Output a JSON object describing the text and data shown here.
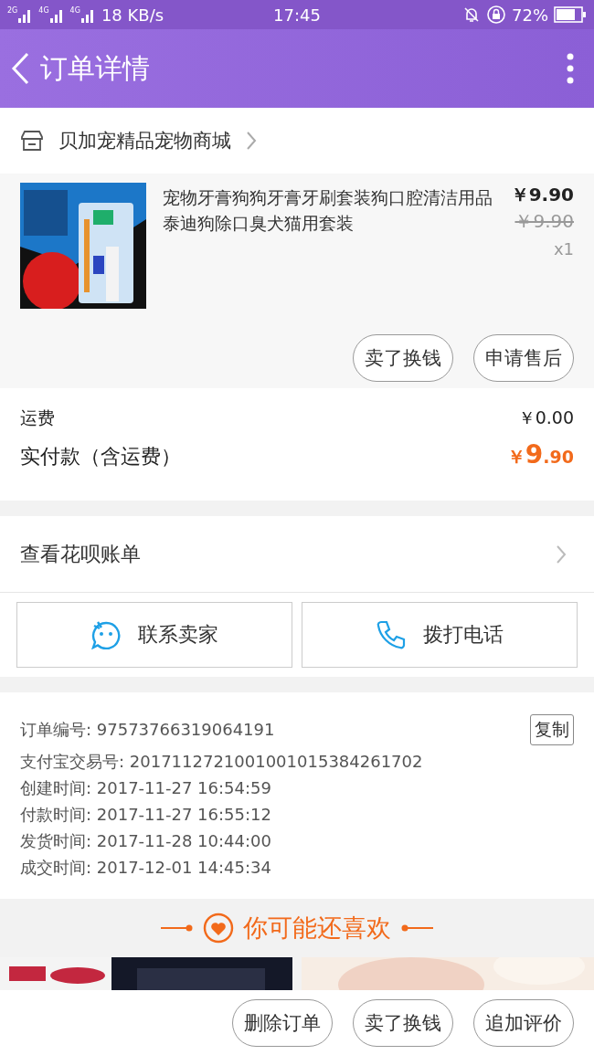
{
  "status_bar": {
    "signals": [
      {
        "label": "2G"
      },
      {
        "label": "4G"
      },
      {
        "label": "4G"
      }
    ],
    "speed": "18 KB/s",
    "time": "17:45",
    "battery": "72%"
  },
  "header": {
    "title": "订单详情"
  },
  "shop": {
    "name": "贝加宠精品宠物商城"
  },
  "product": {
    "kind": "picture",
    "title": "宠物牙膏狗狗牙膏牙刷套装狗口腔清洁用品泰迪狗除口臭犬猫用套装",
    "price": "￥9.90",
    "original_price": "￥9.90",
    "quantity": "x1",
    "actions": [
      "卖了换钱",
      "申请售后"
    ]
  },
  "fees": {
    "shipping_label": "运费",
    "shipping": "￥0.00",
    "paid_label": "实付款（含运费）",
    "paid_symbol": "￥",
    "paid_int": "9",
    "paid_dec": ".90"
  },
  "huabei": {
    "label": "查看花呗账单"
  },
  "contact": [
    {
      "kind": "chat",
      "label": "联系卖家"
    },
    {
      "kind": "phone",
      "label": "拨打电话"
    }
  ],
  "order_info": {
    "copy": "复制",
    "rows": [
      {
        "label": "订单编号:",
        "value": "97573766319064191"
      },
      {
        "label": "支付宝交易号:",
        "value": "2017112721001001015384261702"
      },
      {
        "label": "创建时间:",
        "value": "2017-11-27 16:54:59"
      },
      {
        "label": "付款时间:",
        "value": "2017-11-27 16:55:12"
      },
      {
        "label": "发货时间:",
        "value": "2017-11-28 10:44:00"
      },
      {
        "label": "成交时间:",
        "value": "2017-12-01 14:45:34"
      }
    ]
  },
  "recommend": {
    "title": "你可能还喜欢"
  },
  "bottom_actions": [
    "删除订单",
    "卖了换钱",
    "追加评价"
  ]
}
